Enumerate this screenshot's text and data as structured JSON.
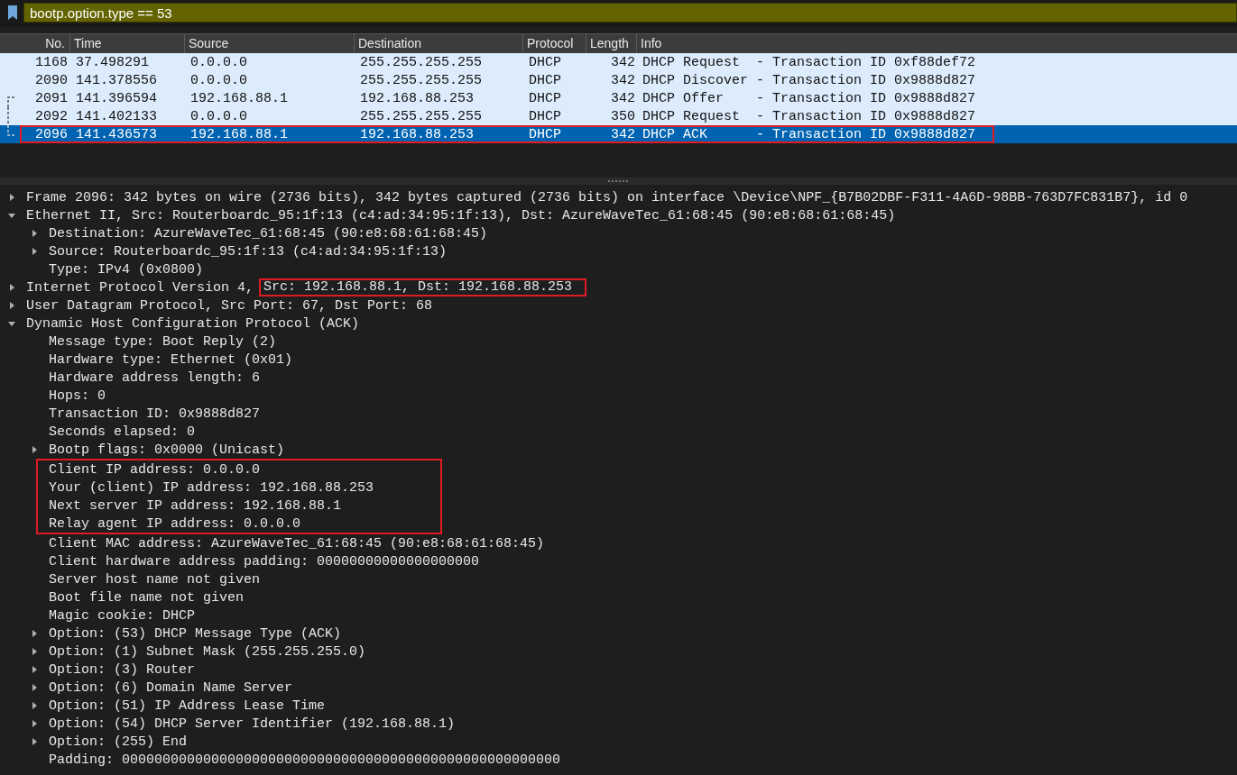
{
  "filter": {
    "value": "bootp.option.type == 53"
  },
  "packet_list": {
    "columns": [
      "No.",
      "Time",
      "Source",
      "Destination",
      "Protocol",
      "Length",
      "Info"
    ],
    "rows": [
      {
        "no": "1168",
        "time": "37.498291",
        "source": "0.0.0.0",
        "destination": "255.255.255.255",
        "protocol": "DHCP",
        "length": "342",
        "info": "DHCP Request  - Transaction ID 0xf88def72",
        "selected": false,
        "boxed": false,
        "kind": "plain"
      },
      {
        "no": "2090",
        "time": "141.378556",
        "source": "0.0.0.0",
        "destination": "255.255.255.255",
        "protocol": "DHCP",
        "length": "342",
        "info": "DHCP Discover - Transaction ID 0x9888d827",
        "selected": false,
        "boxed": false,
        "kind": "plain"
      },
      {
        "no": "2091",
        "time": "141.396594",
        "source": "192.168.88.1",
        "destination": "192.168.88.253",
        "protocol": "DHCP",
        "length": "342",
        "info": "DHCP Offer    - Transaction ID 0x9888d827",
        "selected": false,
        "boxed": false,
        "kind": "conversation-start"
      },
      {
        "no": "2092",
        "time": "141.402133",
        "source": "0.0.0.0",
        "destination": "255.255.255.255",
        "protocol": "DHCP",
        "length": "350",
        "info": "DHCP Request  - Transaction ID 0x9888d827",
        "selected": false,
        "boxed": false,
        "kind": "conversation-middle"
      },
      {
        "no": "2096",
        "time": "141.436573",
        "source": "192.168.88.1",
        "destination": "192.168.88.253",
        "protocol": "DHCP",
        "length": "342",
        "info": "DHCP ACK      - Transaction ID 0x9888d827",
        "selected": true,
        "boxed": true,
        "kind": "conversation-end"
      }
    ]
  },
  "details": [
    {
      "label": "Frame 2096: 342 bytes on wire (2736 bits), 342 bytes captured (2736 bits) on interface \\Device\\NPF_{B7B02DBF-F311-4A6D-98BB-763D7FC831B7}, id 0",
      "expanded": false
    },
    {
      "label": "Ethernet II, Src: Routerboardc_95:1f:13 (c4:ad:34:95:1f:13), Dst: AzureWaveTec_61:68:45 (90:e8:68:61:68:45)",
      "expanded": true,
      "children": [
        {
          "label": "Destination: AzureWaveTec_61:68:45 (90:e8:68:61:68:45)",
          "expanded": false
        },
        {
          "label": "Source: Routerboardc_95:1f:13 (c4:ad:34:95:1f:13)",
          "expanded": false
        },
        {
          "label": "Type: IPv4 (0x0800)"
        }
      ]
    },
    {
      "label": "Internet Protocol Version 4,",
      "boxed_part": "Src: 192.168.88.1, Dst: 192.168.88.253",
      "expanded": false
    },
    {
      "label": "User Datagram Protocol, Src Port: 67, Dst Port: 68",
      "expanded": false
    },
    {
      "label": "Dynamic Host Configuration Protocol (ACK)",
      "expanded": true,
      "children": [
        {
          "label": "Message type: Boot Reply (2)"
        },
        {
          "label": "Hardware type: Ethernet (0x01)"
        },
        {
          "label": "Hardware address length: 6"
        },
        {
          "label": "Hops: 0"
        },
        {
          "label": "Transaction ID: 0x9888d827"
        },
        {
          "label": "Seconds elapsed: 0"
        },
        {
          "label": "Bootp flags: 0x0000 (Unicast)",
          "expanded": false
        },
        {
          "label": "Client IP address: 0.0.0.0",
          "boxed": true
        },
        {
          "label": "Your (client) IP address: 192.168.88.253",
          "boxed": true
        },
        {
          "label": "Next server IP address: 192.168.88.1",
          "boxed": true
        },
        {
          "label": "Relay agent IP address: 0.0.0.0",
          "boxed": true
        },
        {
          "label": "Client MAC address: AzureWaveTec_61:68:45 (90:e8:68:61:68:45)"
        },
        {
          "label": "Client hardware address padding: 00000000000000000000"
        },
        {
          "label": "Server host name not given"
        },
        {
          "label": "Boot file name not given"
        },
        {
          "label": "Magic cookie: DHCP"
        },
        {
          "label": "Option: (53) DHCP Message Type (ACK)",
          "expanded": false
        },
        {
          "label": "Option: (1) Subnet Mask (255.255.255.0)",
          "expanded": false
        },
        {
          "label": "Option: (3) Router",
          "expanded": false
        },
        {
          "label": "Option: (6) Domain Name Server",
          "expanded": false
        },
        {
          "label": "Option: (51) IP Address Lease Time",
          "expanded": false
        },
        {
          "label": "Option: (54) DHCP Server Identifier (192.168.88.1)",
          "expanded": false
        },
        {
          "label": "Option: (255) End",
          "expanded": false
        },
        {
          "label": "Padding: 000000000000000000000000000000000000000000000000000000"
        }
      ]
    }
  ]
}
